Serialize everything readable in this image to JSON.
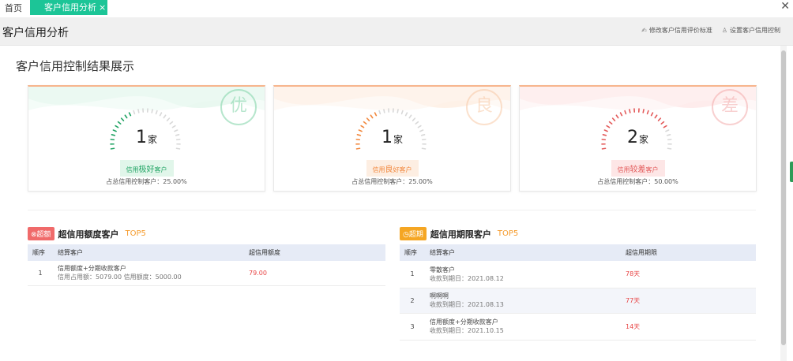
{
  "tabs": {
    "home": "首页",
    "active": "客户信用分析",
    "close_glyph": "×",
    "window_close": "✕"
  },
  "header": {
    "title": "客户信用分析",
    "actions": [
      {
        "icon": "edit-standard-icon",
        "glyph": "✍",
        "label": "修改客户信用评价标准"
      },
      {
        "icon": "user-settings-icon",
        "glyph": "♙",
        "label": "设置客户信用控制"
      }
    ]
  },
  "section_title": "客户信用控制结果展示",
  "cards": [
    {
      "grade": "优",
      "count": "1",
      "unit": "家",
      "tag_prefix": "信用",
      "tag_key": "极好",
      "tag_suffix": "客户",
      "ratio": "占总信用控制客户：25.00%",
      "fill": 0.25,
      "color": "#21a464"
    },
    {
      "grade": "良",
      "count": "1",
      "unit": "家",
      "tag_prefix": "信用",
      "tag_key": "良",
      "tag_suffix": "好客户",
      "ratio": "占总信用控制客户：25.00%",
      "fill": 0.25,
      "color": "#f2883e"
    },
    {
      "grade": "差",
      "count": "2",
      "unit": "家",
      "tag_prefix": "信用",
      "tag_key": "较差",
      "tag_suffix": "客户",
      "ratio": "占总信用控制客户：50.00%",
      "fill": 0.5,
      "color": "#e35a5a"
    }
  ],
  "limit_table": {
    "flag": "⊗超额",
    "flag_color": "#f06a6a",
    "title": "超信用额度客户",
    "top": "TOP5",
    "columns": [
      "顺序",
      "结算客户",
      "超信用额度"
    ],
    "rows": [
      {
        "no": "1",
        "customer": "信用额度+分期收款客户",
        "detail": "信用占用额：5079.00  信用额度：5000.00",
        "value": "79.00"
      }
    ]
  },
  "period_table": {
    "flag": "◷超期",
    "flag_color": "#f5a623",
    "title": "超信用期限客户",
    "top": "TOP5",
    "columns": [
      "顺序",
      "结算客户",
      "超信用期限"
    ],
    "rows": [
      {
        "no": "1",
        "customer": "零散客户",
        "detail": "收款到期日：2021.08.12",
        "value": "78天"
      },
      {
        "no": "2",
        "customer": "啊啊啊",
        "detail": "收款到期日：2021.08.13",
        "value": "77天"
      },
      {
        "no": "3",
        "customer": "信用额度+分期收款客户",
        "detail": "收款到期日：2021.10.15",
        "value": "14天"
      }
    ]
  }
}
